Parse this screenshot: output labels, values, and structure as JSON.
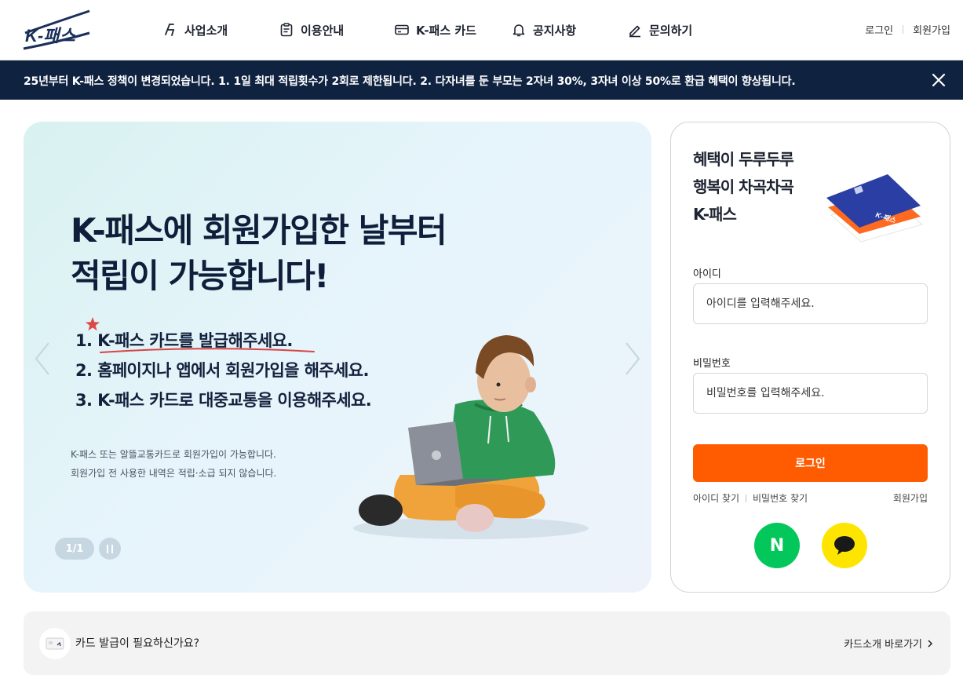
{
  "brand": {
    "logo_text": "K-패스",
    "primary_color": "#1a2f5a",
    "accent_color": "#ff5b00"
  },
  "header": {
    "nav": [
      {
        "label": "사업소개",
        "icon": "k-pass-symbol-icon"
      },
      {
        "label": "이용안내",
        "icon": "clipboard-icon"
      },
      {
        "label": "K-패스 카드",
        "icon": "card-icon"
      },
      {
        "label": "공지사항",
        "icon": "bell-icon"
      },
      {
        "label": "문의하기",
        "icon": "pencil-icon"
      }
    ],
    "login_label": "로그인",
    "signup_label": "회원가입"
  },
  "notice": {
    "text": "25년부터 K-패스 정책이 변경되었습니다. 1. 1일 최대 적립횟수가 2회로 제한됩니다. 2. 다자녀를 둔 부모는 2자녀 30%, 3자녀 이상 50%로 환급 혜택이 향상됩니다.",
    "close_icon": "close-icon"
  },
  "hero": {
    "title": "K-패스에 회원가입한 날부터\n적립이 가능합니다!",
    "steps": [
      "1. K-패스 카드를 발급해주세요.",
      "2. 홈페이지나 앱에서 회원가입을 해주세요.",
      "3. K-패스 카드로 대중교통을 이용해주세요."
    ],
    "note_line1": "K-패스 또는 알뜰교통카드로 회원가입이 가능합니다.",
    "note_line2": "회원가입 전 사용한 내역은 적립·소급 되지 않습니다.",
    "pager": "1/1"
  },
  "login": {
    "tagline": "혜택이 두루두루\n행복이 차곡차곡\nK-패스",
    "card_label": "K-패스",
    "id_label": "아이디",
    "id_placeholder": "아이디를 입력해주세요.",
    "pw_label": "비밀번호",
    "pw_placeholder": "비밀번호를 입력해주세요.",
    "submit_label": "로그인",
    "find_id": "아이디 찾기",
    "find_pw": "비밀번호 찾기",
    "signup": "회원가입",
    "naver_label": "N",
    "naver_color": "#03c75a",
    "kakao_color": "#fee500"
  },
  "card_banner": {
    "text": "카드 발급이 필요하신가요?",
    "link_label": "카드소개 바로가기"
  }
}
